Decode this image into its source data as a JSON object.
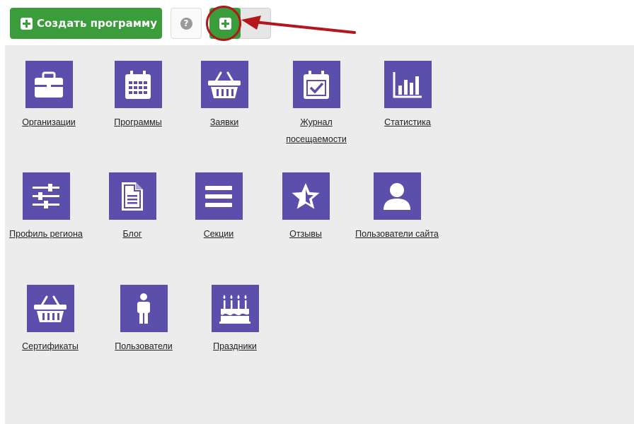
{
  "toolbar": {
    "create_program_label": "Создать программу",
    "help_glyph": "?",
    "add_icon": "plus-square-icon"
  },
  "annotation": {
    "highlight_color": "#b3161b"
  },
  "colors": {
    "primary_green": "#3a9c3a",
    "tile_purple": "#5c4eab",
    "panel_bg": "#ececec"
  },
  "tiles": [
    {
      "label": "Организации",
      "icon": "briefcase-icon"
    },
    {
      "label": "Программы",
      "icon": "calendar-icon"
    },
    {
      "label": "Заявки",
      "icon": "basket-icon"
    },
    {
      "label": "Журнал посещаемости",
      "icon": "calendar-check-icon"
    },
    {
      "label": "Статистика",
      "icon": "bar-chart-icon"
    },
    {
      "label": "Профиль региона",
      "icon": "sliders-icon"
    },
    {
      "label": "Блог",
      "icon": "document-icon"
    },
    {
      "label": "Секции",
      "icon": "list-icon"
    },
    {
      "label": "Отзывы",
      "icon": "star-icon"
    },
    {
      "label": "Пользователи сайта",
      "icon": "user-icon"
    },
    {
      "label": "Сертификаты",
      "icon": "basket-icon"
    },
    {
      "label": "Пользователи",
      "icon": "person-icon"
    },
    {
      "label": "Праздники",
      "icon": "birthday-cake-icon"
    }
  ]
}
